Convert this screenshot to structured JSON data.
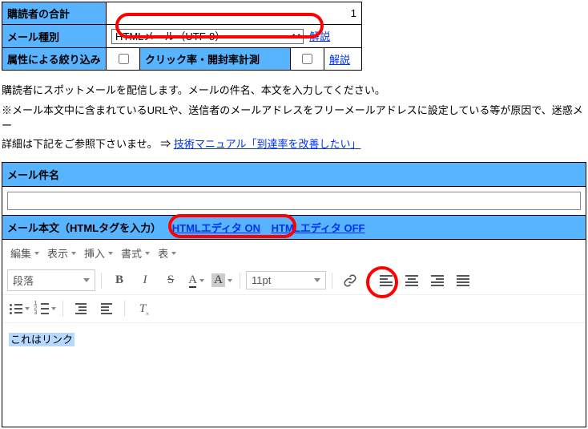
{
  "settings": {
    "row0_label": "購読者の合計",
    "row0_value": "1",
    "mailtype_label": "メール種別",
    "mailtype_value": "HTMLメール（UTF-8）",
    "mailtype_explain": "解説",
    "filter_label": "属性による絞り込み",
    "clickrate_label": "クリック率・開封率計測",
    "clickrate_explain": "解説"
  },
  "description": "購読者にスポットメールを配信します。メールの件名、本文を入力してください。",
  "note": {
    "prefix": "※メール本文中に含まれているURLや、送信者のメールアドレスをフリーメールアドレスに設定している等が原因で、迷惑メー",
    "line2a": "詳細は下記をご参照下さいませ。 ⇒ ",
    "link": "技術マニュアル「到達率を改善したい」"
  },
  "subject_label": "メール件名",
  "subject_value": "",
  "body_label": "メール本文（HTMLタグを入力）",
  "editor_on": "HTMLエディタ ON",
  "editor_off": "HTMLエディタ OFF",
  "toolbar": {
    "menu_edit": "編集",
    "menu_view": "表示",
    "menu_insert": "挿入",
    "menu_format": "書式",
    "menu_table": "表",
    "block_format": "段落",
    "font_size": "11pt"
  },
  "editor_selection": "これはリンク"
}
